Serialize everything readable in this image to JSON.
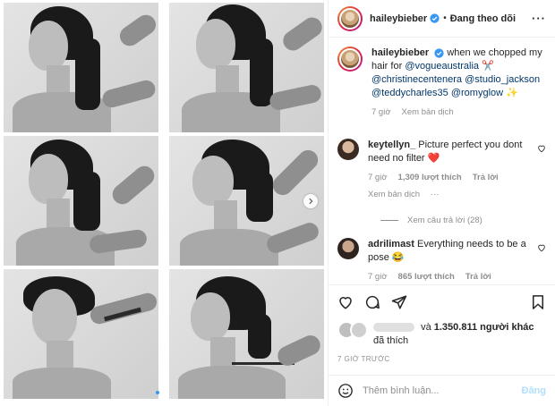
{
  "post": {
    "username": "haileybieber",
    "follow_label": "Đang theo dõi",
    "more_label": "···"
  },
  "caption": {
    "username": "haileybieber",
    "text": "when we chopped my hair for",
    "mention_1": "@vogueaustralia",
    "emoji_scissors": "✂️",
    "mention_2": "@christinecentenera",
    "mention_3": "@studio_jackson",
    "mention_4": "@teddycharles35",
    "mention_5": "@romyglow",
    "emoji_sparkle": "✨",
    "time": "7 giờ",
    "translate": "Xem bản dịch"
  },
  "comments": [
    {
      "username": "keytellyn_",
      "text": "Picture perfect you dont need no filter ❤️",
      "time": "7 giờ",
      "likes": "1,309 lượt thích",
      "reply": "Trả lời",
      "translate": "Xem bản dịch",
      "more": "···"
    },
    {
      "username": "adrilimast",
      "text": "Everything needs to be a pose 😂",
      "time": "7 giờ",
      "likes": "865 lượt thích",
      "reply": "Trả lời"
    }
  ],
  "view_replies": "Xem câu trả lời (28)",
  "likes_summary": {
    "conjunction": "và",
    "count": "1.350.811 người khác",
    "suffix": "đã thích"
  },
  "timestamp": "7 GIỜ TRƯỚC",
  "add_comment": {
    "placeholder": "Thêm bình luận...",
    "post_label": "Đăng"
  },
  "icons": [
    "verified-badge-icon",
    "chevron-right-icon",
    "heart-icon",
    "comment-icon",
    "share-icon",
    "bookmark-icon",
    "emoji-icon"
  ],
  "colors": {
    "link": "#00376b",
    "accent": "#3897f0",
    "muted": "#8e8e8e",
    "post_disabled": "#b2dffc",
    "heart_red": "#ed4956"
  }
}
